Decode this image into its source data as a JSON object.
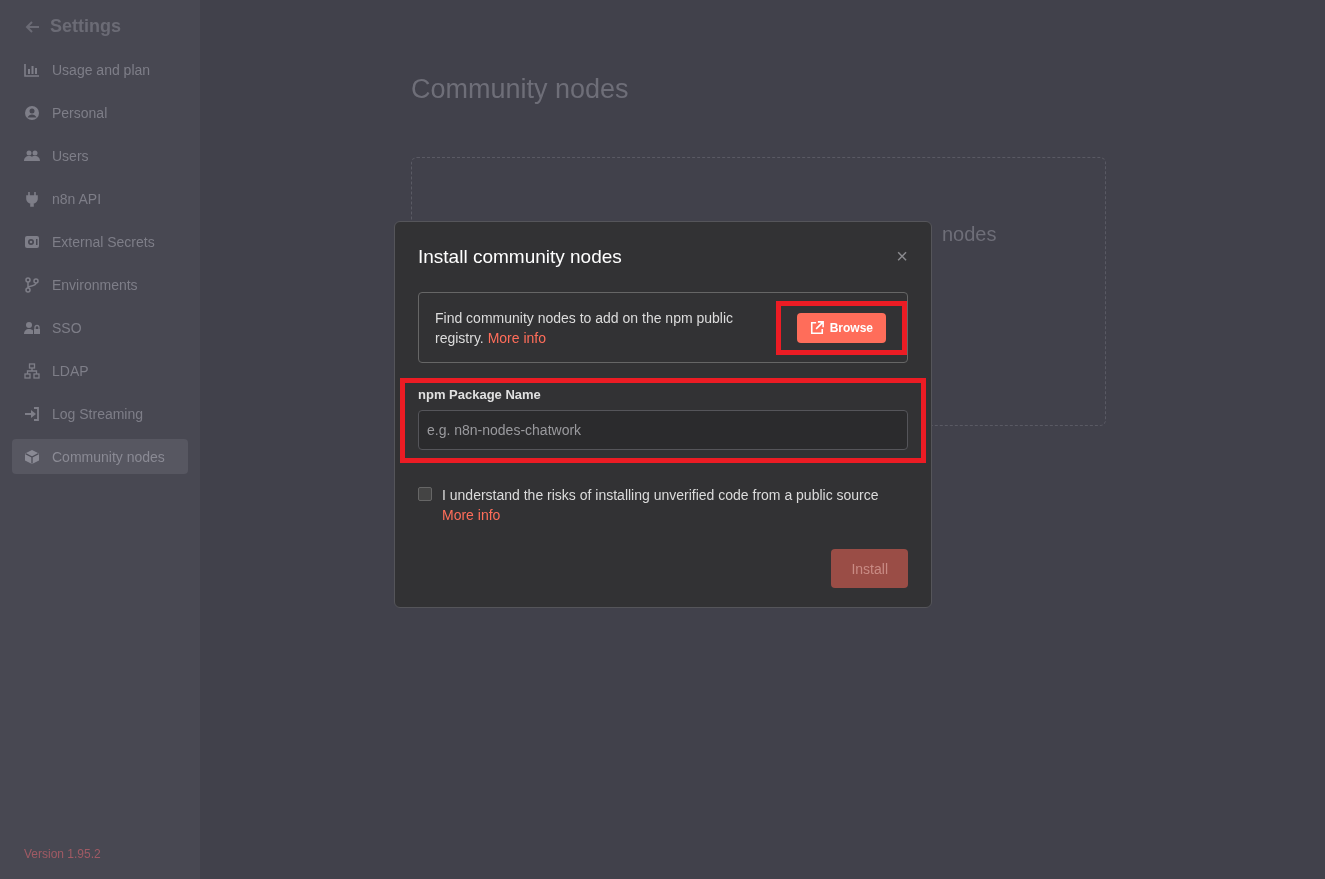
{
  "sidebar": {
    "title": "Settings",
    "items": [
      {
        "label": "Usage and plan",
        "selected": false
      },
      {
        "label": "Personal",
        "selected": false
      },
      {
        "label": "Users",
        "selected": false
      },
      {
        "label": "n8n API",
        "selected": false
      },
      {
        "label": "External Secrets",
        "selected": false
      },
      {
        "label": "Environments",
        "selected": false
      },
      {
        "label": "SSO",
        "selected": false
      },
      {
        "label": "LDAP",
        "selected": false
      },
      {
        "label": "Log Streaming",
        "selected": false
      },
      {
        "label": "Community nodes",
        "selected": true
      }
    ],
    "version": "Version 1.95.2"
  },
  "page": {
    "title": "Community nodes",
    "empty_state_fragment": "nodes"
  },
  "dialog": {
    "title": "Install community nodes",
    "close": "×",
    "info": {
      "text": "Find community nodes to add on the npm public registry.",
      "link": "More info"
    },
    "browse_button": {
      "label": "Browse",
      "highlighted": true
    },
    "package_field": {
      "label": "npm Package Name",
      "placeholder": "e.g. n8n-nodes-chatwork",
      "highlighted": true
    },
    "risk_checkbox": {
      "label": "I understand the risks of installing unverified code from a public source",
      "link": "More info",
      "checked": false
    },
    "install_button": {
      "label": "Install",
      "disabled": true
    }
  }
}
